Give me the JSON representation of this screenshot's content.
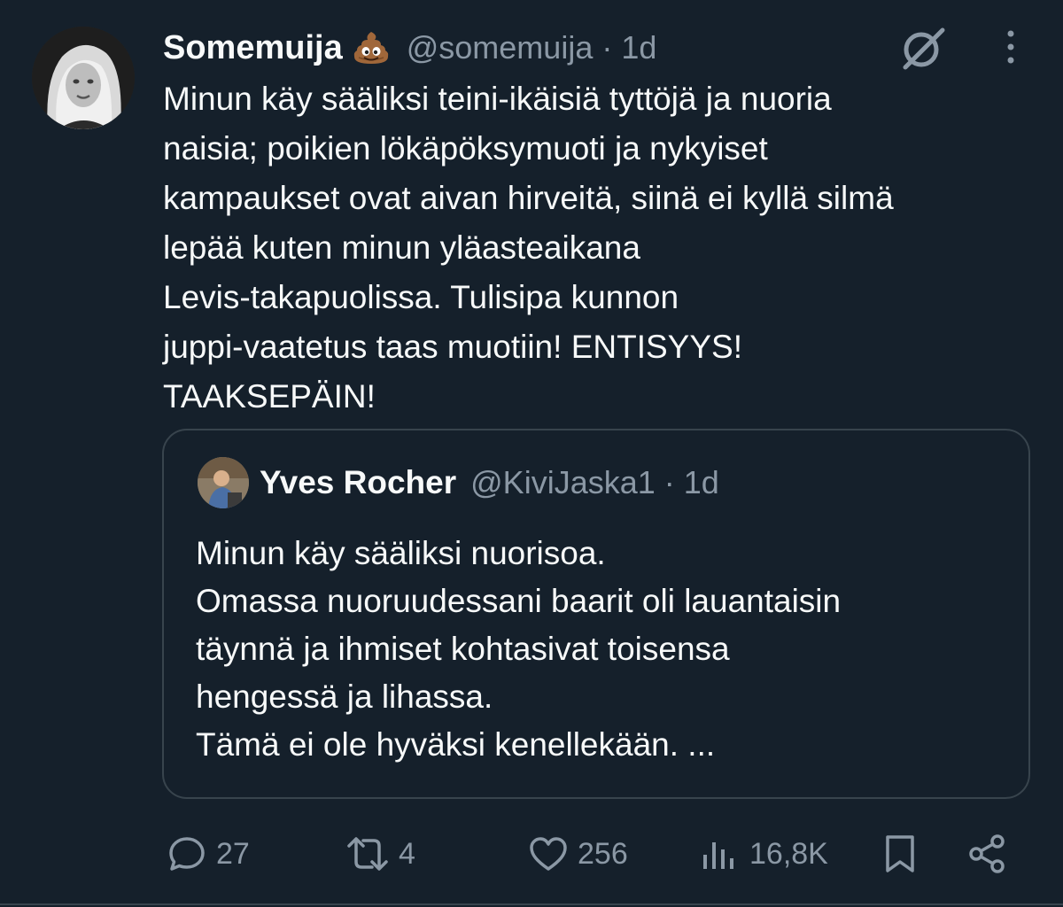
{
  "tweet": {
    "author": {
      "display_name": "Somemuija",
      "emoji": "pile-of-poo-emoji",
      "handle": "@somemuija",
      "separator": "·",
      "time": "1d"
    },
    "text_lines": [
      "Minun käy sääliksi teini-ikäisiä tyttöjä ja nuoria",
      "naisia; poikien lökäpöksymuoti ja nykyiset",
      "kampaukset ovat aivan hirveitä, siinä ei kyllä silmä",
      "lepää kuten minun yläasteaikana",
      "Levis-takapuolissa. Tulisipa kunnon",
      "juppi-vaatetus taas muotiin! ENTISYYS!",
      "TAAKSEPÄIN!"
    ],
    "top_icons": [
      "grok-icon",
      "more-options-icon"
    ]
  },
  "quote": {
    "display_name": "Yves Rocher",
    "handle": "@KiviJaska1",
    "separator": "·",
    "time": "1d",
    "text_lines": [
      "Minun käy sääliksi nuorisoa.",
      "Omassa nuoruudessani baarit oli lauantaisin",
      "täynnä ja ihmiset kohtasivat toisensa",
      "hengessä ja lihassa.",
      "Tämä ei ole hyväksi kenellekään. ..."
    ]
  },
  "actions": {
    "replies": "27",
    "reposts": "4",
    "likes": "256",
    "views": "16,8K",
    "icons": [
      "reply-icon",
      "repost-icon",
      "like-icon",
      "views-icon",
      "bookmark-icon",
      "share-icon"
    ]
  },
  "colors": {
    "background": "#15202b",
    "text_primary": "#f7f9f9",
    "text_secondary": "#8b98a5",
    "border": "#38444d"
  }
}
